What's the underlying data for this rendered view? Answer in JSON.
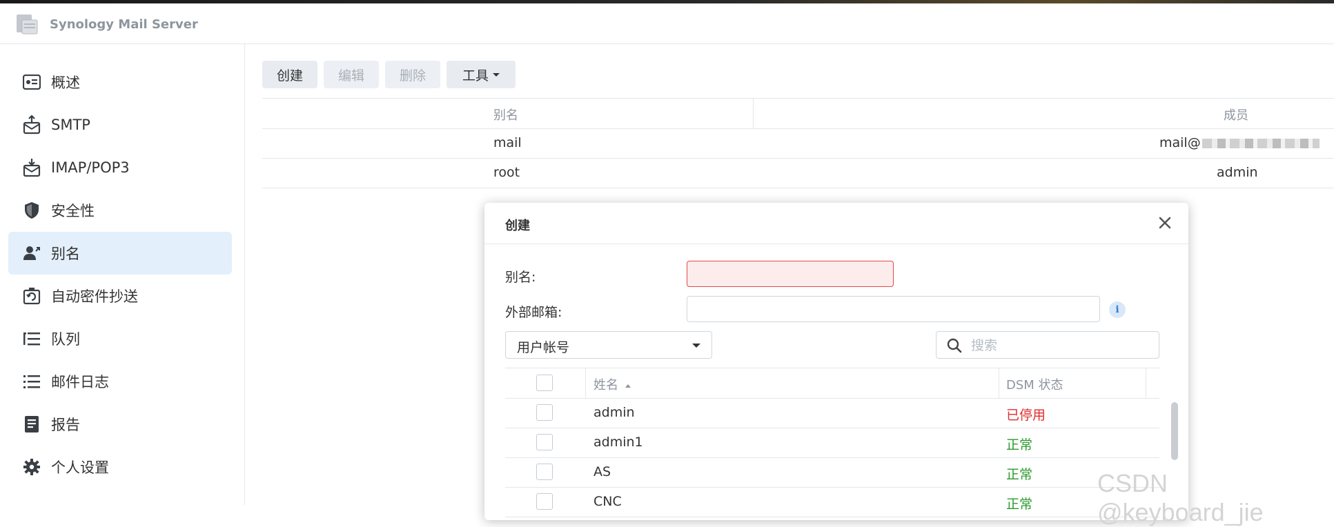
{
  "app": {
    "title": "Synology Mail Server"
  },
  "sidebar": {
    "items": [
      {
        "label": "概述",
        "icon": "overview-icon"
      },
      {
        "label": "SMTP",
        "icon": "smtp-icon"
      },
      {
        "label": "IMAP/POP3",
        "icon": "imap-icon"
      },
      {
        "label": "安全性",
        "icon": "shield-icon"
      },
      {
        "label": "别名",
        "icon": "alias-user-icon",
        "active": true
      },
      {
        "label": "自动密件抄送",
        "icon": "auto-bcc-icon"
      },
      {
        "label": "队列",
        "icon": "queue-icon"
      },
      {
        "label": "邮件日志",
        "icon": "mail-log-icon"
      },
      {
        "label": "报告",
        "icon": "report-icon"
      },
      {
        "label": "个人设置",
        "icon": "gear-icon"
      }
    ]
  },
  "toolbar": {
    "create": "创建",
    "edit": "编辑",
    "delete": "删除",
    "tools": "工具"
  },
  "alias_table": {
    "columns": [
      "别名",
      "成员"
    ],
    "rows": [
      {
        "alias": "mail",
        "member": "mail@"
      },
      {
        "alias": "root",
        "member": "admin"
      }
    ]
  },
  "dialog": {
    "title": "创建",
    "alias_label": "别名:",
    "alias_value": "",
    "external_label": "外部邮箱:",
    "external_value": "",
    "type_select": "用户帐号",
    "search_placeholder": "搜索",
    "columns": {
      "name": "姓名",
      "status": "DSM 状态"
    },
    "users": [
      {
        "name": "admin",
        "status": "已停用",
        "status_color": "#e02c2c"
      },
      {
        "name": "admin1",
        "status": "正常",
        "status_color": "#2b9a2b"
      },
      {
        "name": "AS",
        "status": "正常",
        "status_color": "#2b9a2b"
      },
      {
        "name": "CNC",
        "status": "正常",
        "status_color": "#2b9a2b"
      }
    ]
  },
  "watermark": "CSDN @keyboard_jie",
  "colors": {
    "accent": "#2f7bd1",
    "active_bg": "#e3effb",
    "error": "#e04a4a"
  }
}
